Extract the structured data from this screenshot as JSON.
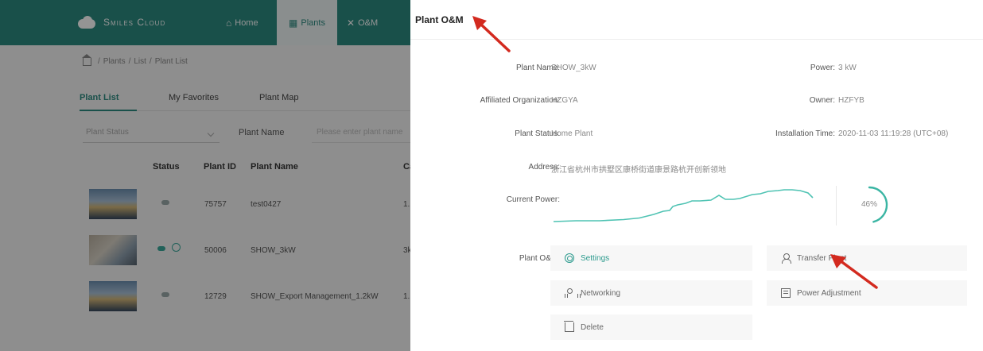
{
  "app": {
    "brand": "Smiles Cloud",
    "nav": [
      {
        "label": "Home",
        "icon": "home-icon"
      },
      {
        "label": "Plants",
        "icon": "plants-icon"
      },
      {
        "label": "O&M",
        "icon": "tools-icon"
      }
    ],
    "breadcrumb": [
      "Plants",
      "List",
      "Plant List"
    ],
    "tabs": [
      "Plant List",
      "My Favorites",
      "Plant Map"
    ],
    "filters": {
      "status_placeholder": "Plant Status",
      "name_label": "Plant Name",
      "name_placeholder": "Please enter plant name"
    },
    "table": {
      "headers": [
        "Status",
        "Plant ID",
        "Plant Name",
        "Ca"
      ],
      "rows": [
        {
          "plant_id": "75757",
          "name": "test0427",
          "extra": "1."
        },
        {
          "plant_id": "50006",
          "name": "SHOW_3kW",
          "extra": "3k"
        },
        {
          "plant_id": "12729",
          "name": "SHOW_Export Management_1.2kW",
          "extra": "1."
        }
      ]
    }
  },
  "drawer": {
    "title": "Plant O&M",
    "fields": {
      "plant_name_label": "Plant Name:",
      "plant_name": "SHOW_3kW",
      "power_label": "Power:",
      "power": "3 kW",
      "org_label": "Affiliated Organization:",
      "org": "HZGYA",
      "owner_label": "Owner:",
      "owner": "HZFYB",
      "status_label": "Plant Status:",
      "status": "Home Plant",
      "install_label": "Installation Time:",
      "install": "2020-11-03 11:19:28 (UTC+08)",
      "address_label": "Address:",
      "address": "浙江省杭州市拱墅区康桥街道康景路杭开创新领地",
      "current_power_label": "Current Power:"
    },
    "gauge_percent": 46,
    "gauge_text": "46%",
    "om_label": "Plant O&M:",
    "actions": [
      {
        "label": "Settings",
        "icon": "gear-icon",
        "active": true
      },
      {
        "label": "Transfer Plant",
        "icon": "user-icon",
        "active": false
      },
      {
        "label": "Networking",
        "icon": "network-icon",
        "active": false
      },
      {
        "label": "Power Adjustment",
        "icon": "power-adjust-icon",
        "active": false
      },
      {
        "label": "Delete",
        "icon": "trash-icon",
        "active": false
      }
    ]
  },
  "colors": {
    "brand_teal": "#2b8a80",
    "accent_green": "#2b9a8d",
    "annotation_red": "#d32a1f"
  }
}
